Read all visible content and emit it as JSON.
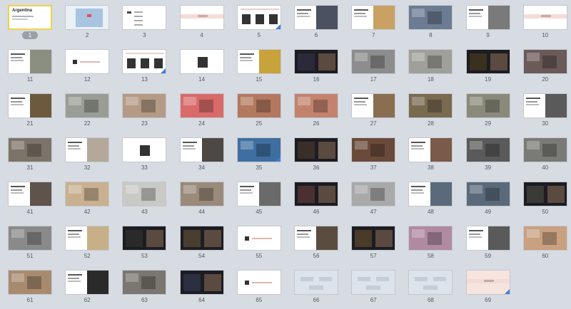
{
  "app": {
    "view": "slide-sorter"
  },
  "selected_slide": 1,
  "slides": [
    {
      "n": "1",
      "kind": "title",
      "title": "Argentina",
      "color": "#ffffff"
    },
    {
      "n": "2",
      "kind": "map",
      "color": "#e9f0f6"
    },
    {
      "n": "3",
      "kind": "agenda",
      "color": "#ffffff"
    },
    {
      "n": "4",
      "kind": "blank-pink",
      "color": "#ffffff"
    },
    {
      "n": "5",
      "kind": "three-boxes",
      "color": "#ffffff"
    },
    {
      "n": "6",
      "kind": "photo-text",
      "color": "#4a5160"
    },
    {
      "n": "7",
      "kind": "photo-text",
      "color": "#c9a165"
    },
    {
      "n": "8",
      "kind": "photo",
      "color": "#6b7b92"
    },
    {
      "n": "9",
      "kind": "photo-text",
      "color": "#7a7a7a"
    },
    {
      "n": "10",
      "kind": "blank-pink",
      "color": "#ffffff"
    },
    {
      "n": "11",
      "kind": "photo-text",
      "color": "#8a8f80"
    },
    {
      "n": "12",
      "kind": "section",
      "color": "#ffffff"
    },
    {
      "n": "13",
      "kind": "three-boxes",
      "color": "#ffffff"
    },
    {
      "n": "14",
      "kind": "single-box",
      "color": "#ffffff"
    },
    {
      "n": "15",
      "kind": "photo-text",
      "color": "#c8a23a"
    },
    {
      "n": "16",
      "kind": "dark",
      "color": "#2a2a38"
    },
    {
      "n": "17",
      "kind": "photo",
      "color": "#8d8d8d"
    },
    {
      "n": "18",
      "kind": "photo",
      "color": "#a0a09a"
    },
    {
      "n": "19",
      "kind": "dark",
      "color": "#3a3020"
    },
    {
      "n": "20",
      "kind": "photo",
      "color": "#6a5a58"
    },
    {
      "n": "21",
      "kind": "photo-text",
      "color": "#6d5a3e"
    },
    {
      "n": "22",
      "kind": "photo",
      "color": "#9a9d95"
    },
    {
      "n": "23",
      "kind": "photo",
      "color": "#b59a85"
    },
    {
      "n": "24",
      "kind": "photo",
      "color": "#d96a6a"
    },
    {
      "n": "25",
      "kind": "photo",
      "color": "#b3785e"
    },
    {
      "n": "26",
      "kind": "photo",
      "color": "#c2826e"
    },
    {
      "n": "27",
      "kind": "photo-text",
      "color": "#8a6e50"
    },
    {
      "n": "28",
      "kind": "photo",
      "color": "#7a6a50"
    },
    {
      "n": "29",
      "kind": "photo",
      "color": "#8a8a7a"
    },
    {
      "n": "30",
      "kind": "photo-text",
      "color": "#5a5a5a"
    },
    {
      "n": "31",
      "kind": "photo",
      "color": "#7c7468"
    },
    {
      "n": "32",
      "kind": "photo-text",
      "color": "#b4a89a"
    },
    {
      "n": "33",
      "kind": "single-box",
      "color": "#ffffff"
    },
    {
      "n": "34",
      "kind": "photo-text",
      "color": "#4d4844"
    },
    {
      "n": "35",
      "kind": "photo",
      "color": "#3f6fa0"
    },
    {
      "n": "36",
      "kind": "dark",
      "color": "#3a2e28"
    },
    {
      "n": "37",
      "kind": "photo",
      "color": "#6a4a3a"
    },
    {
      "n": "38",
      "kind": "photo-text",
      "color": "#7a5a48"
    },
    {
      "n": "39",
      "kind": "photo",
      "color": "#5a5a5a"
    },
    {
      "n": "40",
      "kind": "photo",
      "color": "#7a7a76"
    },
    {
      "n": "41",
      "kind": "photo-text",
      "color": "#5e544c"
    },
    {
      "n": "42",
      "kind": "photo",
      "color": "#c8b090"
    },
    {
      "n": "43",
      "kind": "photo",
      "color": "#c9c9c5"
    },
    {
      "n": "44",
      "kind": "photo",
      "color": "#9a8a7a"
    },
    {
      "n": "45",
      "kind": "photo-text",
      "color": "#6a6a6a"
    },
    {
      "n": "46",
      "kind": "dark",
      "color": "#4a3030"
    },
    {
      "n": "47",
      "kind": "photo",
      "color": "#a9a9a9"
    },
    {
      "n": "48",
      "kind": "photo-text",
      "color": "#5a6a7a"
    },
    {
      "n": "49",
      "kind": "photo",
      "color": "#5a6a7a"
    },
    {
      "n": "50",
      "kind": "dark",
      "color": "#3a3a36"
    },
    {
      "n": "51",
      "kind": "photo",
      "color": "#8a8a8a"
    },
    {
      "n": "52",
      "kind": "photo-text",
      "color": "#c7b088"
    },
    {
      "n": "53",
      "kind": "dark",
      "color": "#2a2a2a"
    },
    {
      "n": "54",
      "kind": "dark",
      "color": "#4a3e30"
    },
    {
      "n": "55",
      "kind": "section",
      "color": "#ffffff"
    },
    {
      "n": "56",
      "kind": "photo-text",
      "color": "#5a4c3e"
    },
    {
      "n": "57",
      "kind": "dark",
      "color": "#4a3a28"
    },
    {
      "n": "58",
      "kind": "photo",
      "color": "#b08aa0"
    },
    {
      "n": "59",
      "kind": "photo-text",
      "color": "#5a5a5a"
    },
    {
      "n": "60",
      "kind": "photo",
      "color": "#c9a080"
    },
    {
      "n": "61",
      "kind": "photo",
      "color": "#a88a6e"
    },
    {
      "n": "62",
      "kind": "photo-text",
      "color": "#2a2a2a"
    },
    {
      "n": "63",
      "kind": "photo",
      "color": "#7a7670"
    },
    {
      "n": "64",
      "kind": "dark",
      "color": "#2a3040"
    },
    {
      "n": "65",
      "kind": "section",
      "color": "#ffffff"
    },
    {
      "n": "66",
      "kind": "diagram",
      "color": "#dce3ea"
    },
    {
      "n": "67",
      "kind": "diagram",
      "color": "#dce3ea"
    },
    {
      "n": "68",
      "kind": "diagram",
      "color": "#dce3ea"
    },
    {
      "n": "69",
      "kind": "blank-pink",
      "color": "#f6e4de"
    }
  ]
}
